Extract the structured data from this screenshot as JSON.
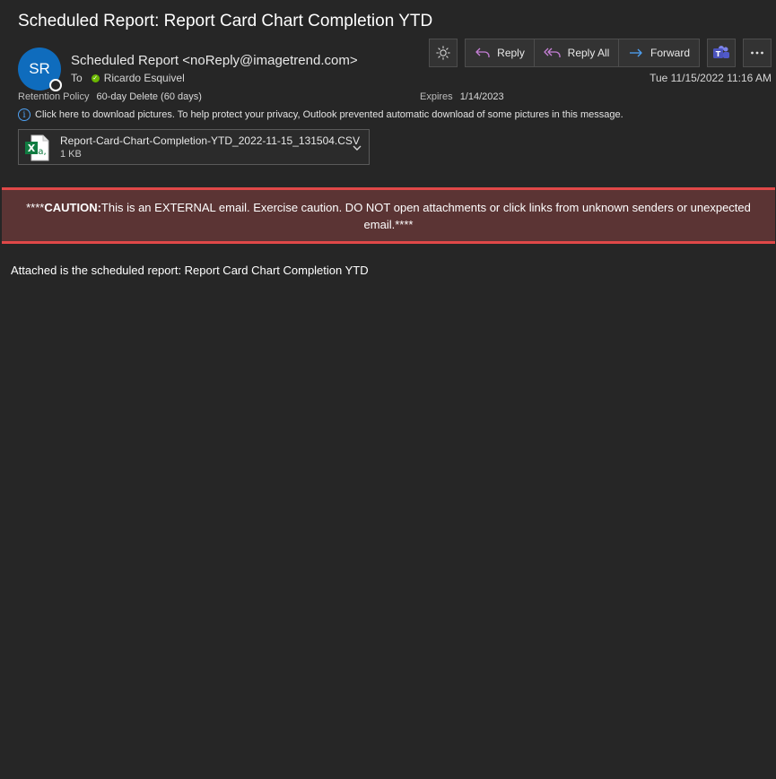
{
  "email": {
    "subject": "Scheduled Report: Report Card Chart Completion YTD",
    "avatar_initials": "SR",
    "sender": "Scheduled Report <noReply@imagetrend.com>",
    "to_label": "To",
    "recipient": "Ricardo Esquivel",
    "retention_label": "Retention Policy",
    "retention_value": "60-day Delete (60 days)",
    "expires_label": "Expires",
    "expires_value": "1/14/2023",
    "date": "Tue 11/15/2022 11:16 AM",
    "info_message": "Click here to download pictures. To help protect your privacy, Outlook prevented automatic download of some pictures in this message."
  },
  "attachment": {
    "name": "Report-Card-Chart-Completion-YTD_2022-11-15_131504.CSV",
    "size": "1 KB"
  },
  "toolbar": {
    "reply_label": "Reply",
    "reply_all_label": "Reply All",
    "forward_label": "Forward"
  },
  "caution": {
    "prefix": "****",
    "bold": "CAUTION:",
    "text": "This is an EXTERNAL email. Exercise caution. DO NOT open attachments or click links from unknown senders or unexpected email.****"
  },
  "body": {
    "text": "Attached is the scheduled report: Report Card Chart Completion YTD"
  },
  "colors": {
    "background": "#262626",
    "avatar": "#0f6cbd",
    "caution_bg": "#5b3434",
    "caution_border": "#e04848",
    "reply_icon": "#c57fd6",
    "forward_icon": "#4ea1f3",
    "presence": "#6bb700"
  }
}
